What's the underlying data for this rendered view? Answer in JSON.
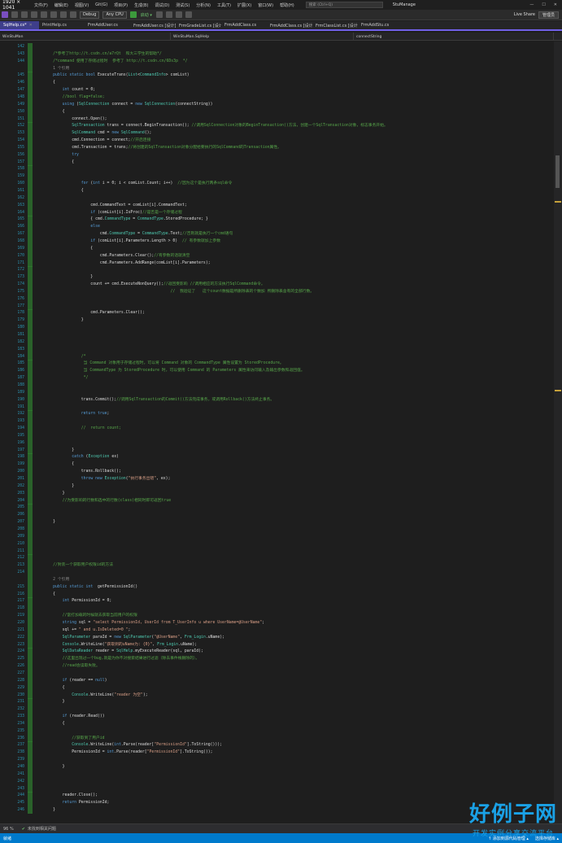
{
  "menu": {
    "dims": "1920 × 1041",
    "items": [
      "文件(F)",
      "编辑(E)",
      "视图(V)",
      "Git(G)",
      "项目(P)",
      "生成(B)",
      "调试(D)",
      "测试(S)",
      "分析(N)",
      "工具(T)",
      "扩展(X)",
      "窗口(W)",
      "帮助(H)"
    ],
    "search_placeholder": "搜索 (Ctrl+Q)",
    "app_title": "StuManage",
    "window_buttons": [
      "—",
      "☐",
      "✕"
    ]
  },
  "toolbar": {
    "config": "Debug",
    "platform": "Any CPU",
    "run_label": "启动 ▾",
    "live_share": "Live Share",
    "admin": "管理员"
  },
  "tabs": [
    {
      "label": "SqlHelp.cs*",
      "active": true
    },
    {
      "label": "PrintHelp.cs",
      "active": false
    },
    {
      "label": "FrmAddUser.cs",
      "active": false
    },
    {
      "label": "FrmAddUser.cs [设计]",
      "active": false
    },
    {
      "label": "FrmGradeList.cs [设计]",
      "active": false
    },
    {
      "label": "FrmAddClass.cs",
      "active": false
    },
    {
      "label": "FrmAddClass.cs [设计]",
      "active": false
    },
    {
      "label": "FrmClassList.cs [设计]",
      "active": false
    },
    {
      "label": "FrmAddStu.cs",
      "active": false
    }
  ],
  "navbar": {
    "project": "WinStuMan",
    "class": "WinStuMan.SqlHelp",
    "member": "connectString"
  },
  "lines": [
    {
      "n": "142",
      "code": ""
    },
    {
      "n": "143",
      "code": "        /*参考了http://t.csdn.cn/a7rQt  和大三学生的帮助*/"
    },
    {
      "n": "144",
      "code": "        /*command 使用了存储过程时  参考了 http://t.csdn.cn/6Ds3p  */"
    },
    {
      "n": "",
      "code": "        1 个引用"
    },
    {
      "n": "145",
      "code": "        public static bool ExecuteTrans(List<CommandInfo> comList)"
    },
    {
      "n": "146",
      "code": "        {"
    },
    {
      "n": "147",
      "code": "            int count = 0;"
    },
    {
      "n": "148",
      "code": "            //bool flag=false;"
    },
    {
      "n": "149",
      "code": "            using (SqlConnection connect = new SqlConnection(connectString))"
    },
    {
      "n": "150",
      "code": "            {"
    },
    {
      "n": "151",
      "code": "                connect.Open();"
    },
    {
      "n": "152",
      "code": "                SqlTransaction trans = connect.BeginTransaction(); //调用SqlConnection对象的BeginTransaction()方法，创建一个SqlTransaction对象，标志事务开始。"
    },
    {
      "n": "153",
      "code": "                SqlCommand cmd = new SqlCommand();"
    },
    {
      "n": "154",
      "code": "                cmd.Connection = connect;//开启连接"
    },
    {
      "n": "155",
      "code": "                cmd.Transaction = trans;//将创建的SqlTransaction对象分配给要执行的SqlCommand的Transaction属性。"
    },
    {
      "n": "156",
      "code": "                try"
    },
    {
      "n": "157",
      "code": "                {"
    },
    {
      "n": "158",
      "code": ""
    },
    {
      "n": "159",
      "code": ""
    },
    {
      "n": "160",
      "code": "                    for (int i = 0; i < comList.Count; i++)  //因为这个是执行两条sql命令"
    },
    {
      "n": "161",
      "code": "                    {"
    },
    {
      "n": "162",
      "code": ""
    },
    {
      "n": "163",
      "code": "                        cmd.CommandText = comList[i].CommandText;"
    },
    {
      "n": "164",
      "code": "                        if (comList[i].IsProc)//是否是一个存储过程"
    },
    {
      "n": "165",
      "code": "                        { cmd.CommandType = CommandType.StoredProcedure; }"
    },
    {
      "n": "166",
      "code": "                        else"
    },
    {
      "n": "167",
      "code": "                            cmd.CommandType = CommandType.Text;//否则就是执行一个cmd语句"
    },
    {
      "n": "168",
      "code": "                        if (comList[i].Parameters.Length > 0)  // 有参数就加上参数"
    },
    {
      "n": "169",
      "code": "                        {"
    },
    {
      "n": "170",
      "code": "                            cmd.Parameters.Clear();//有参数的话就清空"
    },
    {
      "n": "171",
      "code": "                            cmd.Parameters.AddRange(comList[i].Parameters);"
    },
    {
      "n": "172",
      "code": ""
    },
    {
      "n": "173",
      "code": "                        }"
    },
    {
      "n": "174",
      "code": "                        count += cmd.ExecuteNonQuery();//返回受影响 //调用相应的方法执行SqlCommand命令。"
    },
    {
      "n": "175",
      "code": "                                                          //  我验证了   这个count数据是所删除表的个数加 所删除表含有的全部行数。"
    },
    {
      "n": "176",
      "code": ""
    },
    {
      "n": "177",
      "code": ""
    },
    {
      "n": "178",
      "code": "                        cmd.Parameters.Clear();"
    },
    {
      "n": "179",
      "code": "                    }"
    },
    {
      "n": "180",
      "code": ""
    },
    {
      "n": "181",
      "code": ""
    },
    {
      "n": "182",
      "code": ""
    },
    {
      "n": "183",
      "code": ""
    },
    {
      "n": "184",
      "code": "                    /*"
    },
    {
      "n": "185",
      "code": "                     当 Command 对象用于存储过程时，可以将 Command 对象的 CommandType 属性设置为 StoredProcedure。"
    },
    {
      "n": "186",
      "code": "                     当 CommandType 为 StoredProcedure 时，可以使用 Command 的 Parameters 属性来访问输入及输出参数和返回值。"
    },
    {
      "n": "187",
      "code": "                     */"
    },
    {
      "n": "188",
      "code": ""
    },
    {
      "n": "189",
      "code": ""
    },
    {
      "n": "190",
      "code": "                    trans.Commit();//调用SqlTransaction的Commit()方法完成事务，或调用Rollback()方法终止事务。"
    },
    {
      "n": "191",
      "code": ""
    },
    {
      "n": "192",
      "code": "                    return true;"
    },
    {
      "n": "193",
      "code": ""
    },
    {
      "n": "194",
      "code": "                    //  return count;"
    },
    {
      "n": "195",
      "code": ""
    },
    {
      "n": "196",
      "code": ""
    },
    {
      "n": "197",
      "code": "                }"
    },
    {
      "n": "198",
      "code": "                catch (Exception ex)"
    },
    {
      "n": "199",
      "code": "                {"
    },
    {
      "n": "200",
      "code": "                    trans.Rollback();"
    },
    {
      "n": "201",
      "code": "                    throw new Exception(\"执行事务出错\", ex);"
    },
    {
      "n": "202",
      "code": "                }"
    },
    {
      "n": "203",
      "code": "            }"
    },
    {
      "n": "204",
      "code": "            //为受影响的行数和选中的行数(class)相同时即可返回true"
    },
    {
      "n": "205",
      "code": ""
    },
    {
      "n": "206",
      "code": ""
    },
    {
      "n": "207",
      "code": "        }"
    },
    {
      "n": "208",
      "code": ""
    },
    {
      "n": "209",
      "code": ""
    },
    {
      "n": "210",
      "code": ""
    },
    {
      "n": "211",
      "code": ""
    },
    {
      "n": "212",
      "code": ""
    },
    {
      "n": "213",
      "code": "        //封装一个获取用户权限id的方法"
    },
    {
      "n": "214",
      "code": ""
    },
    {
      "n": "",
      "code": "        2 个引用"
    },
    {
      "n": "215",
      "code": "        public static int  getPermissionId()"
    },
    {
      "n": "216",
      "code": "        {"
    },
    {
      "n": "217",
      "code": "            int PermissionId = 0;"
    },
    {
      "n": "218",
      "code": ""
    },
    {
      "n": "219",
      "code": "            //當打加载的时候就去获取当前用户的权限"
    },
    {
      "n": "220",
      "code": "            string sql = \"select PermissionId, UserId from T_UserInfo u where UserName=@UserName\";"
    },
    {
      "n": "221",
      "code": "            sql += \" and u.IsDeleted=0 \";"
    },
    {
      "n": "222",
      "code": "            SqlParameter paraId = new SqlParameter(\"@UserName\", Frm_Login.uName);"
    },
    {
      "n": "223",
      "code": "            Console.WriteLine(\"获取到的uName为: {0}\", Frm_Login.uName);"
    },
    {
      "n": "224",
      "code": "            SqlDataReader reader = SqlHelp.myExecuteReader(sql, paraId);"
    },
    {
      "n": "225",
      "code": "            //这里出现过一个bug,就是为你不对搜索结果进行过滤（除去事件根删除的）。"
    },
    {
      "n": "226",
      "code": "            //read会读取失败。"
    },
    {
      "n": "227",
      "code": ""
    },
    {
      "n": "228",
      "code": "            if (reader == null)"
    },
    {
      "n": "229",
      "code": "            {"
    },
    {
      "n": "230",
      "code": "                Console.WriteLine(\"reader 为空\");"
    },
    {
      "n": "231",
      "code": "            }"
    },
    {
      "n": "232",
      "code": ""
    },
    {
      "n": "233",
      "code": "            if (reader.Read())"
    },
    {
      "n": "234",
      "code": "            {"
    },
    {
      "n": "235",
      "code": ""
    },
    {
      "n": "236",
      "code": "                //获取到了用户id"
    },
    {
      "n": "237",
      "code": "                Console.WriteLine(int.Parse(reader[\"PermissionId\"].ToString()));"
    },
    {
      "n": "238",
      "code": "                PermissionId = int.Parse(reader[\"PermissionId\"].ToString());"
    },
    {
      "n": "239",
      "code": ""
    },
    {
      "n": "240",
      "code": "            }"
    },
    {
      "n": "241",
      "code": ""
    },
    {
      "n": "242",
      "code": ""
    },
    {
      "n": "243",
      "code": ""
    },
    {
      "n": "244",
      "code": "            reader.Close();"
    },
    {
      "n": "245",
      "code": "            return PermissionId;"
    },
    {
      "n": "246",
      "code": "        }"
    }
  ],
  "status": {
    "zoom": "96 %",
    "issues": "未找到相关问题"
  },
  "bottombar": {
    "left": "就绪",
    "right1": "↑ 添加到源代码管理 ▴",
    "right2": "选择存储库 ▴"
  },
  "watermark": {
    "big": "好例子网",
    "small": "开发实例分享交流平台"
  },
  "colors": {
    "accent": "#7160e8",
    "statusbar": "#007acc",
    "keyword": "#569cd6",
    "type": "#4ec9b0",
    "comment": "#57a64a",
    "string": "#d69d85"
  }
}
